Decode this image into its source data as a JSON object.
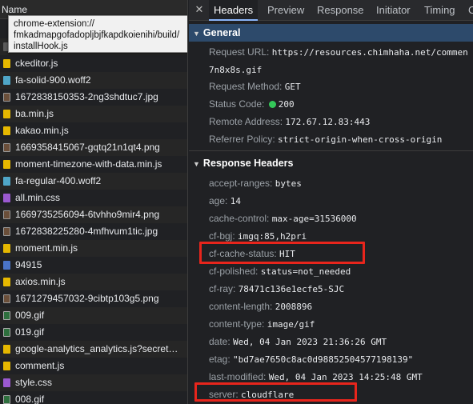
{
  "list": {
    "header": "Name",
    "tooltip": [
      "chrome-extension://",
      "fmkadmapgofadopljbjfkapdkoienihi/build/",
      "installHook.js"
    ],
    "items": [
      {
        "name": "ckeditor.js",
        "type": "js"
      },
      {
        "name": "fa-solid-900.woff2",
        "type": "font"
      },
      {
        "name": "1672838150353-2ng3shdtuc7.jpg",
        "type": "img"
      },
      {
        "name": "ba.min.js",
        "type": "js"
      },
      {
        "name": "kakao.min.js",
        "type": "js"
      },
      {
        "name": "1669358415067-gqtq21n1qt4.png",
        "type": "img"
      },
      {
        "name": "moment-timezone-with-data.min.js",
        "type": "js"
      },
      {
        "name": "fa-regular-400.woff2",
        "type": "font"
      },
      {
        "name": "all.min.css",
        "type": "css"
      },
      {
        "name": "1669735256094-6tvhho9mir4.png",
        "type": "img"
      },
      {
        "name": "1672838225280-4mfhvum1tic.jpg",
        "type": "img"
      },
      {
        "name": "moment.min.js",
        "type": "js"
      },
      {
        "name": "94915",
        "type": "doc"
      },
      {
        "name": "axios.min.js",
        "type": "js"
      },
      {
        "name": "1671279457032-9cibtp103g5.png",
        "type": "img"
      },
      {
        "name": "009.gif",
        "type": "gif"
      },
      {
        "name": "019.gif",
        "type": "gif"
      },
      {
        "name": "google-analytics_analytics.js?secret…",
        "type": "js"
      },
      {
        "name": "comment.js",
        "type": "js"
      },
      {
        "name": "style.css",
        "type": "css"
      },
      {
        "name": "008.gif",
        "type": "gif"
      }
    ]
  },
  "tabs": {
    "close": "✕",
    "items": [
      "Headers",
      "Preview",
      "Response",
      "Initiator",
      "Timing",
      "C"
    ],
    "active": "Headers"
  },
  "general": {
    "title": "General",
    "request_url_key": "Request URL:",
    "request_url_1": "https://resources.chimhaha.net/commen",
    "request_url_2": "7n8x8s.gif",
    "method_key": "Request Method:",
    "method": "GET",
    "status_key": "Status Code:",
    "status": "200",
    "remote_key": "Remote Address:",
    "remote": "172.67.12.83:443",
    "referrer_key": "Referrer Policy:",
    "referrer": "strict-origin-when-cross-origin"
  },
  "response_headers": {
    "title": "Response Headers",
    "items": [
      {
        "k": "accept-ranges:",
        "v": "bytes"
      },
      {
        "k": "age:",
        "v": "14"
      },
      {
        "k": "cache-control:",
        "v": "max-age=31536000"
      },
      {
        "k": "cf-bgj:",
        "v": "imgq:85,h2pri"
      },
      {
        "k": "cf-cache-status:",
        "v": "HIT"
      },
      {
        "k": "cf-polished:",
        "v": "status=not_needed"
      },
      {
        "k": "cf-ray:",
        "v": "78471c136e1ecfe5-SJC"
      },
      {
        "k": "content-length:",
        "v": "2008896"
      },
      {
        "k": "content-type:",
        "v": "image/gif"
      },
      {
        "k": "date:",
        "v": "Wed, 04 Jan 2023 21:36:26 GMT"
      },
      {
        "k": "etag:",
        "v": "\"bd7ae7650c8ac0d98852504577198139\""
      },
      {
        "k": "last-modified:",
        "v": "Wed, 04 Jan 2023 14:25:48 GMT"
      },
      {
        "k": "server:",
        "v": "cloudflare"
      }
    ]
  },
  "colors": {
    "highlight": "#e8251c",
    "status_ok": "#34c759",
    "section_bg": "#2d4a6b"
  }
}
